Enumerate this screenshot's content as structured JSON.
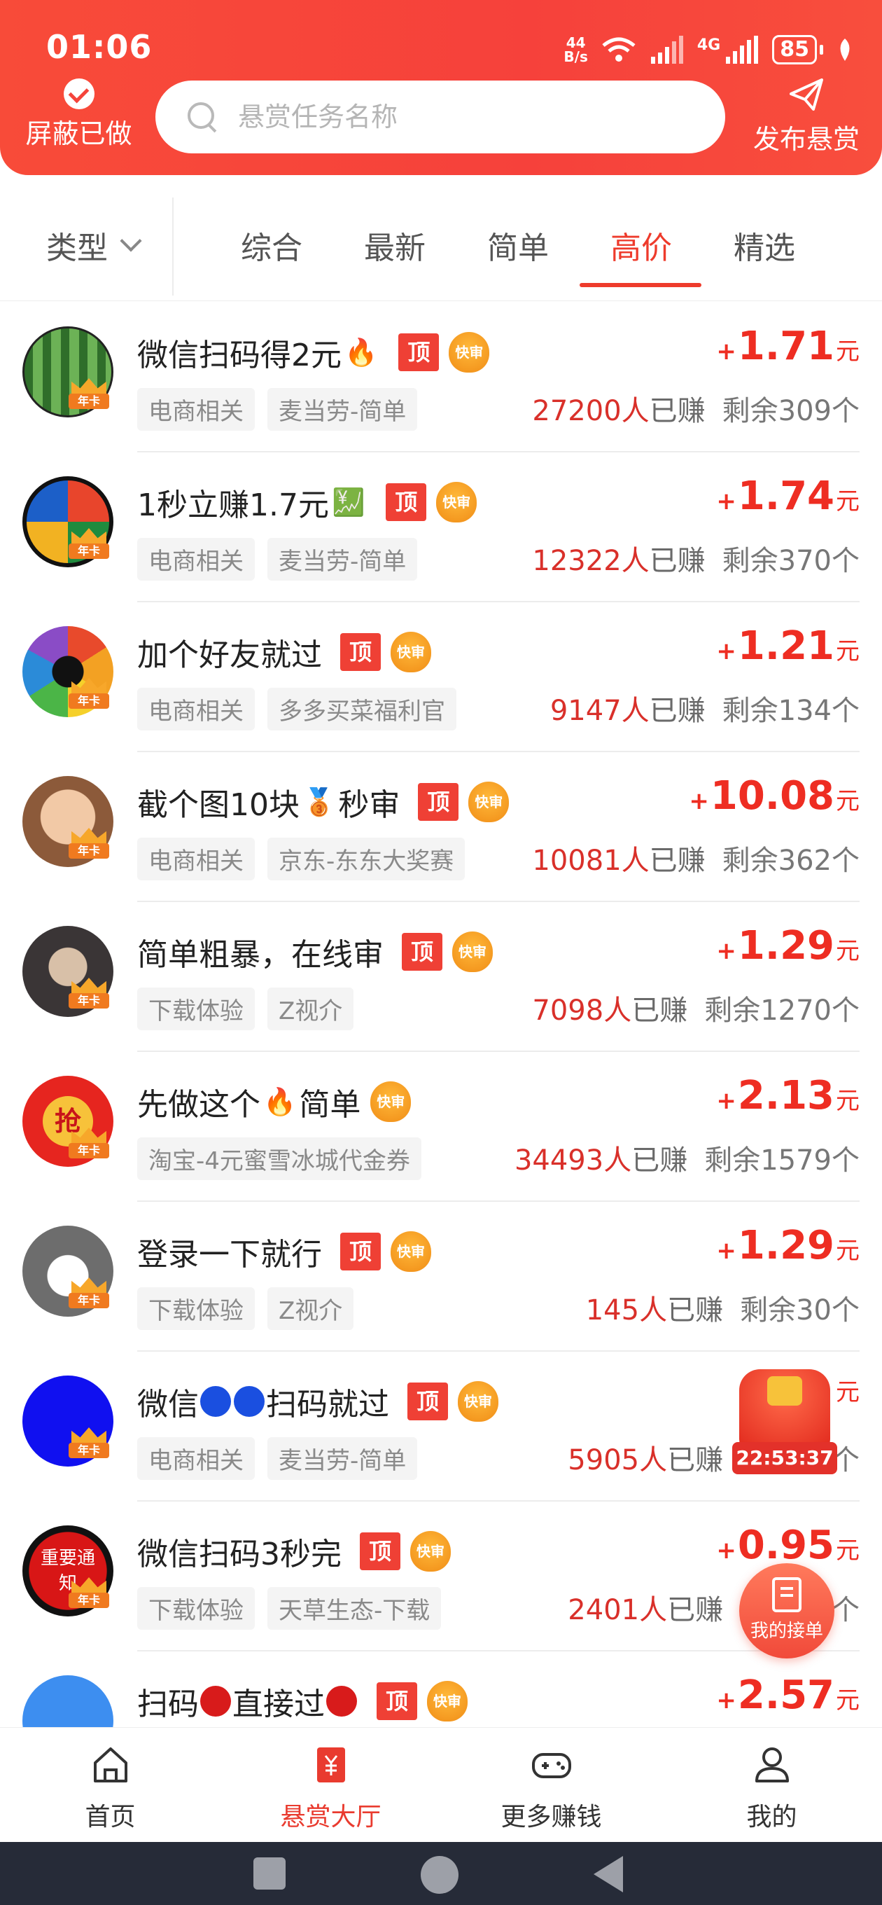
{
  "status_bar": {
    "time": "01:06",
    "net_speed_top": "44",
    "net_speed_bottom": "B/s",
    "network": "4G",
    "battery": "85"
  },
  "header": {
    "hide_done_label": "屏蔽已做",
    "search_placeholder": "悬赏任务名称",
    "publish_label": "发布悬赏"
  },
  "filter": {
    "type_label": "类型",
    "tabs": [
      {
        "label": "综合"
      },
      {
        "label": "最新"
      },
      {
        "label": "简单"
      },
      {
        "label": "高价",
        "active": true
      },
      {
        "label": "精选"
      }
    ]
  },
  "tasks": [
    {
      "title": "微信扫码得2元",
      "title_emoji": "🔥",
      "top": "顶",
      "fast": "快审",
      "tags": [
        "电商相关",
        "麦当劳-简单"
      ],
      "plus": "+",
      "amount": "1.71",
      "unit": "元",
      "earned_num": "27200人",
      "earned_label": "已赚",
      "remaining": "剩余309个",
      "avatar_color": "#3e8a3a"
    },
    {
      "title": "1秒立赚1.7元",
      "title_emoji": "💹",
      "top": "顶",
      "fast": "快审",
      "tags": [
        "电商相关",
        "麦当劳-简单"
      ],
      "plus": "+",
      "amount": "1.74",
      "unit": "元",
      "earned_num": "12322人",
      "earned_label": "已赚",
      "remaining": "剩余370个",
      "avatar_color": "#e84a2c"
    },
    {
      "title": "加个好友就过",
      "title_emoji": "",
      "top": "顶",
      "fast": "快审",
      "tags": [
        "电商相关",
        "多多买菜福利官"
      ],
      "plus": "+",
      "amount": "1.21",
      "unit": "元",
      "earned_num": "9147人",
      "earned_label": "已赚",
      "remaining": "剩余134个",
      "avatar_color": "#f3a123"
    },
    {
      "title": "截个图10块",
      "title_emoji": "🥉",
      "title_suffix": "秒审",
      "top": "顶",
      "fast": "快审",
      "tags": [
        "电商相关",
        "京东-东东大奖赛"
      ],
      "plus": "+",
      "amount": "10.08",
      "unit": "元",
      "earned_num": "10081人",
      "earned_label": "已赚",
      "remaining": "剩余362个",
      "avatar_color": "#e9b48a"
    },
    {
      "title": "简单粗暴，在线审",
      "title_emoji": "",
      "top": "顶",
      "fast": "快审",
      "tags": [
        "下载体验",
        "Z视介"
      ],
      "plus": "+",
      "amount": "1.29",
      "unit": "元",
      "earned_num": "7098人",
      "earned_label": "已赚",
      "remaining": "剩余1270个",
      "avatar_color": "#4b4d55"
    },
    {
      "title": "先做这个",
      "title_emoji": "🔥",
      "title_suffix": "简单",
      "top": "",
      "fast": "快审",
      "tags": [
        "淘宝-4元蜜雪冰城代金券"
      ],
      "plus": "+",
      "amount": "2.13",
      "unit": "元",
      "earned_num": "34493人",
      "earned_label": "已赚",
      "remaining": "剩余1579个",
      "avatar_color": "#e6251f",
      "avatar_text": "抢"
    },
    {
      "title": "登录一下就行",
      "title_emoji": "",
      "top": "顶",
      "fast": "快审",
      "tags": [
        "下载体验",
        "Z视介"
      ],
      "plus": "+",
      "amount": "1.29",
      "unit": "元",
      "earned_num": "145人",
      "earned_label": "已赚",
      "remaining": "剩余30个",
      "avatar_color": "#6d6d6d"
    },
    {
      "title_prefix": "微信",
      "title": "扫码就过",
      "circles": [
        "#1a4fe0",
        "#1a4fe0"
      ],
      "top": "顶",
      "fast": "快审",
      "tags": [
        "电商相关",
        "麦当劳-简单"
      ],
      "plus": "",
      "amount": "",
      "unit": "元",
      "earned_num": "5905人",
      "earned_label": "已赚",
      "remaining": "剩余69个",
      "avatar_color": "#1010f0"
    },
    {
      "title": "微信扫码3秒完",
      "title_emoji": "",
      "top": "顶",
      "fast": "快审",
      "tags": [
        "下载体验",
        "天草生态-下载"
      ],
      "plus": "+",
      "amount": "0.95",
      "unit": "元",
      "earned_num": "2401人",
      "earned_label": "已赚",
      "remaining": "剩余50个",
      "avatar_color": "#d81616",
      "avatar_text": "重要通知"
    },
    {
      "title_prefix": "扫码",
      "title": "直接过",
      "circles": [
        "#d81b1b",
        "#d81b1b"
      ],
      "top": "顶",
      "fast": "快审",
      "tags": [],
      "plus": "+",
      "amount": "2.57",
      "unit": "元",
      "earned_num": "",
      "earned_label": "",
      "remaining": "",
      "avatar_color": "#3d8ef0"
    }
  ],
  "crown_label": "年卡",
  "floating": {
    "redpack_timer": "22:53:37",
    "my_orders_label": "我的接单"
  },
  "bottom_nav": [
    {
      "label": "首页",
      "icon": "home-icon"
    },
    {
      "label": "悬赏大厅",
      "icon": "reward-hall-icon",
      "active": true
    },
    {
      "label": "更多赚钱",
      "icon": "gamepad-icon"
    },
    {
      "label": "我的",
      "icon": "profile-icon"
    }
  ]
}
